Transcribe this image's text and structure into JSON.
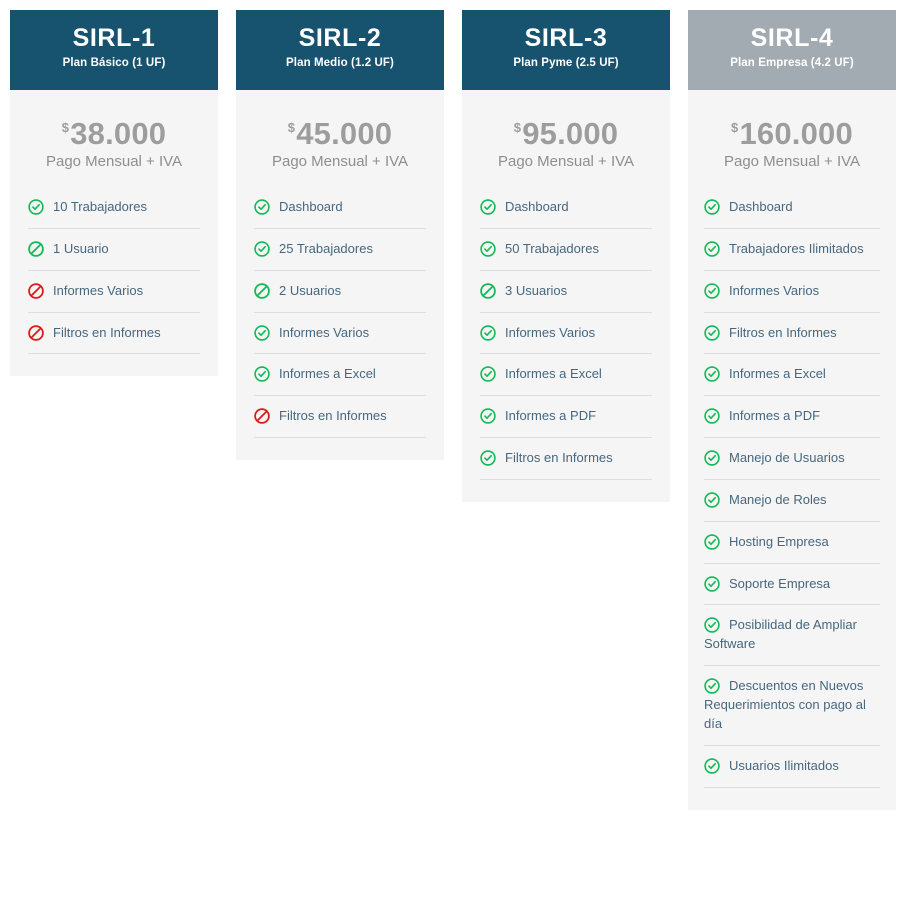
{
  "theme": {
    "header_primary_color": "#17536e",
    "header_highlight_color": "#a3abb2",
    "card_background": "#f5f5f5",
    "page_background": "#ffffff",
    "price_color": "#9d9d9d",
    "feature_text_color": "#46677e",
    "icon_yes_color": "#12b956",
    "icon_limited_color": "#12b956",
    "icon_no_color": "#e01818",
    "divider_color": "#dedede"
  },
  "icon_legend": {
    "yes": "check-circle-icon",
    "limited": "prohibition-circle-green-icon",
    "no": "prohibition-circle-red-icon"
  },
  "plans": [
    {
      "code": "SIRL-1",
      "subtitle": "Plan Básico (1 UF)",
      "currency_symbol": "$",
      "price": "38.000",
      "period": "Pago Mensual + IVA",
      "highlighted": false,
      "features": [
        {
          "label": "10 Trabajadores",
          "status": "yes"
        },
        {
          "label": "1 Usuario",
          "status": "limited"
        },
        {
          "label": "Informes Varios",
          "status": "no"
        },
        {
          "label": "Filtros en Informes",
          "status": "no"
        }
      ]
    },
    {
      "code": "SIRL-2",
      "subtitle": "Plan Medio (1.2 UF)",
      "currency_symbol": "$",
      "price": "45.000",
      "period": "Pago Mensual + IVA",
      "highlighted": false,
      "features": [
        {
          "label": "Dashboard",
          "status": "yes"
        },
        {
          "label": "25 Trabajadores",
          "status": "yes"
        },
        {
          "label": "2 Usuarios",
          "status": "limited"
        },
        {
          "label": "Informes Varios",
          "status": "yes"
        },
        {
          "label": "Informes a Excel",
          "status": "yes"
        },
        {
          "label": "Filtros en Informes",
          "status": "no"
        }
      ]
    },
    {
      "code": "SIRL-3",
      "subtitle": "Plan Pyme (2.5 UF)",
      "currency_symbol": "$",
      "price": "95.000",
      "period": "Pago Mensual + IVA",
      "highlighted": false,
      "features": [
        {
          "label": "Dashboard",
          "status": "yes"
        },
        {
          "label": "50 Trabajadores",
          "status": "yes"
        },
        {
          "label": "3 Usuarios",
          "status": "limited"
        },
        {
          "label": "Informes Varios",
          "status": "yes"
        },
        {
          "label": "Informes a Excel",
          "status": "yes"
        },
        {
          "label": "Informes a PDF",
          "status": "yes"
        },
        {
          "label": "Filtros en Informes",
          "status": "yes"
        }
      ]
    },
    {
      "code": "SIRL-4",
      "subtitle": "Plan Empresa (4.2 UF)",
      "currency_symbol": "$",
      "price": "160.000",
      "period": "Pago Mensual + IVA",
      "highlighted": true,
      "features": [
        {
          "label": "Dashboard",
          "status": "yes"
        },
        {
          "label": "Trabajadores Ilimitados",
          "status": "yes"
        },
        {
          "label": "Informes Varios",
          "status": "yes"
        },
        {
          "label": "Filtros en Informes",
          "status": "yes"
        },
        {
          "label": "Informes a Excel",
          "status": "yes"
        },
        {
          "label": "Informes a PDF",
          "status": "yes"
        },
        {
          "label": "Manejo de Usuarios",
          "status": "yes"
        },
        {
          "label": "Manejo de Roles",
          "status": "yes"
        },
        {
          "label": "Hosting Empresa",
          "status": "yes"
        },
        {
          "label": "Soporte Empresa",
          "status": "yes"
        },
        {
          "label": "Posibilidad de Ampliar Software",
          "status": "yes"
        },
        {
          "label": "Descuentos en Nuevos Requerimientos con pago al día",
          "status": "yes"
        },
        {
          "label": "Usuarios Ilimitados",
          "status": "yes"
        }
      ]
    }
  ]
}
